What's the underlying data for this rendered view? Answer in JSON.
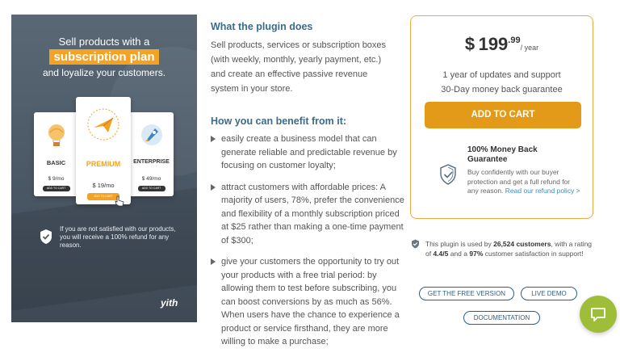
{
  "promo": {
    "headline_line1": "Sell products with a",
    "headline_highlight": "subscription plan",
    "headline_line3": "and loyalize your customers.",
    "cards": [
      {
        "name": "BASIC",
        "price": "$ 9/mo",
        "button": "ADD TO CART"
      },
      {
        "name": "PREMIUM",
        "price": "$ 19/mo",
        "button": "ADD TO CART"
      },
      {
        "name": "ENTERPRISE",
        "price": "$ 49/mo",
        "button": "ADD TO CART"
      }
    ],
    "guarantee_text": "If you are not satisfied with our products, you will receive a 100% refund for any reason.",
    "logo_text": "yith"
  },
  "description": {
    "what_heading": "What the plugin does",
    "what_text": "Sell products, services or subscription boxes (with weekly, monthly, yearly payment, etc.) and create an effective passive revenue system in your store.",
    "benefit_heading": "How you can benefit from it:",
    "benefits": [
      "easily create a business model that can generate reliable and predictable revenue by focusing on customer loyalty;",
      "attract customers with affordable prices: A majority of users, 78%, prefer the convenience and flexibility of a monthly subscription priced at $25 rather than making a one-time payment of $300;",
      "give your customers the opportunity to try out your products with a free trial period: by allowing them to test before subscribing, you can boost conversions by as much as 56%. When users have the chance to experience a product or service firsthand, they are more willing to make a purchase;"
    ]
  },
  "pricing": {
    "currency": "$",
    "amount": "199",
    "cents": ".99",
    "period": "/ year",
    "feature1": "1 year of updates and support",
    "feature2": "30-Day money back guarantee",
    "add_to_cart": "ADD TO CART",
    "money_back_title": "100% Money Back Guarantee",
    "money_back_text": "Buy confidently with our buyer protection and get a full refund for any reason.",
    "refund_link": "Read our refund policy >"
  },
  "stats": {
    "prefix": "This plugin is used by ",
    "customers": "26,524 customers",
    "mid": ", with a rating of ",
    "rating": "4.4/5",
    "and": " and a ",
    "satisfaction": "97%",
    "suffix": " customer satisfaction in support!"
  },
  "buttons": {
    "free_version": "GET THE FREE VERSION",
    "live_demo": "LIVE DEMO",
    "documentation": "DOCUMENTATION"
  },
  "colors": {
    "accent_orange": "#e39a19",
    "heading_blue": "#3b6c8a",
    "link_blue": "#3c8dc2",
    "chat_green": "#9ebe3a"
  },
  "icons": [
    "shield-check-icon",
    "chat-bubble-icon",
    "triangle-bullet-icon"
  ]
}
